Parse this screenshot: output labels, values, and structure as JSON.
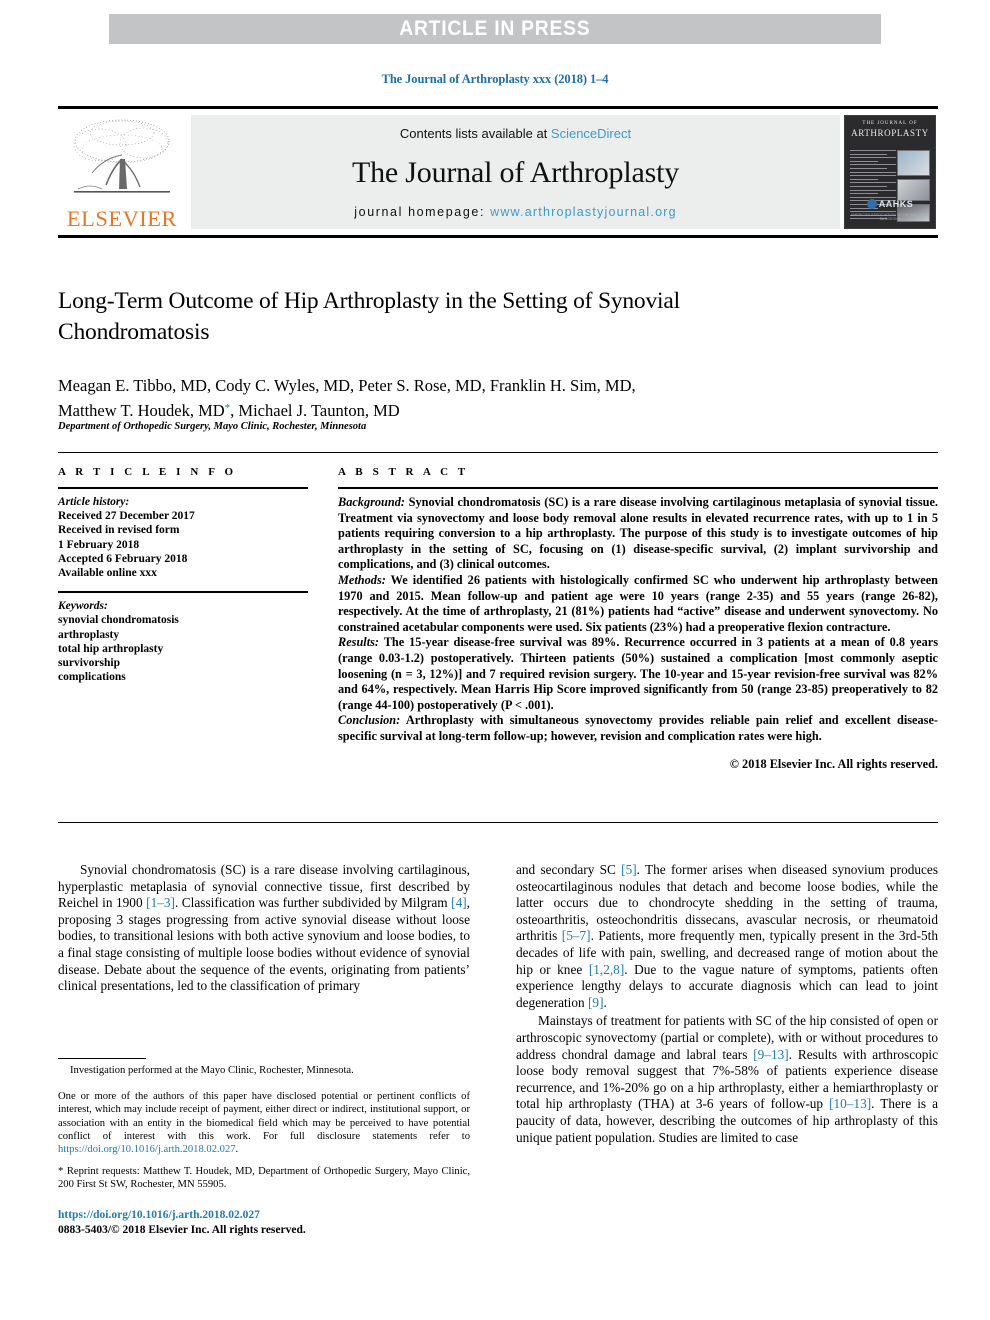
{
  "banner": {
    "text": "ARTICLE IN PRESS",
    "background_color": "#c2c4c6",
    "text_color": "#ffffff"
  },
  "running_head": "The Journal of Arthroplasty xxx (2018) 1–4",
  "masthead": {
    "publisher_logo_text": "ELSEVIER",
    "publisher_logo_color": "#e87722",
    "contents_prefix": "Contents lists available at ",
    "contents_link": "ScienceDirect",
    "journal_title": "The Journal of Arthroplasty",
    "homepage_prefix": "journal homepage: ",
    "homepage_url": "www.arthroplastyjournal.org",
    "link_color": "#3a9bd0",
    "cover": {
      "line1": "THE JOURNAL OF",
      "line2": "ARTHROPLASTY",
      "society": "AAHKS",
      "society_sub": "AMERICAN ASSOCIATION OF HIP AND KNEE SURGEONS"
    }
  },
  "article": {
    "title": "Long-Term Outcome of Hip Arthroplasty in the Setting of Synovial Chondromatosis",
    "authors_line1": "Meagan E. Tibbo, MD, Cody C. Wyles, MD, Peter S. Rose, MD, Franklin H. Sim, MD,",
    "authors_line2_a": "Matthew T. Houdek, MD",
    "authors_corresponding_marker": "*",
    "authors_line2_b": ", Michael J. Taunton, MD",
    "affiliation": "Department of Orthopedic Surgery, Mayo Clinic, Rochester, Minnesota"
  },
  "article_info": {
    "heading": "A R T I C L E   I N F O",
    "history_label": "Article history:",
    "history": [
      "Received 27 December 2017",
      "Received in revised form",
      "1 February 2018",
      "Accepted 6 February 2018",
      "Available online xxx"
    ],
    "keywords_label": "Keywords:",
    "keywords": [
      "synovial chondromatosis",
      "arthroplasty",
      "total hip arthroplasty",
      "survivorship",
      "complications"
    ]
  },
  "abstract": {
    "heading": "A B S T R A C T",
    "sections": [
      {
        "label": "Background:",
        "text": " Synovial chondromatosis (SC) is a rare disease involving cartilaginous metaplasia of synovial tissue. Treatment via synovectomy and loose body removal alone results in elevated recurrence rates, with up to 1 in 5 patients requiring conversion to a hip arthroplasty. The purpose of this study is to investigate outcomes of hip arthroplasty in the setting of SC, focusing on (1) disease-specific survival, (2) implant survivorship and complications, and (3) clinical outcomes."
      },
      {
        "label": "Methods:",
        "text": " We identified 26 patients with histologically confirmed SC who underwent hip arthroplasty between 1970 and 2015. Mean follow-up and patient age were 10 years (range 2-35) and 55 years (range 26-82), respectively. At the time of arthroplasty, 21 (81%) patients had “active” disease and underwent synovectomy. No constrained acetabular components were used. Six patients (23%) had a preoperative flexion contracture."
      },
      {
        "label": "Results:",
        "text": " The 15-year disease-free survival was 89%. Recurrence occurred in 3 patients at a mean of 0.8 years (range 0.03-1.2) postoperatively. Thirteen patients (50%) sustained a complication [most commonly aseptic loosening (n = 3, 12%)] and 7 required revision surgery. The 10-year and 15-year revision-free survival was 82% and 64%, respectively. Mean Harris Hip Score improved significantly from 50 (range 23-85) preoperatively to 82 (range 44-100) postoperatively (P < .001)."
      },
      {
        "label": "Conclusion:",
        "text": " Arthroplasty with simultaneous synovectomy provides reliable pain relief and excellent disease-specific survival at long-term follow-up; however, revision and complication rates were high."
      }
    ],
    "copyright": "© 2018 Elsevier Inc. All rights reserved."
  },
  "body": {
    "left_paragraphs": [
      {
        "parts": [
          {
            "t": "Synovial chondromatosis (SC) is a rare disease involving cartilaginous, hyperplastic metaplasia of synovial connective tissue, first described by Reichel in 1900 ",
            "ref": false
          },
          {
            "t": "[1–3]",
            "ref": true
          },
          {
            "t": ". Classification was further subdivided by Milgram ",
            "ref": false
          },
          {
            "t": "[4]",
            "ref": true
          },
          {
            "t": ", proposing 3 stages progressing from active synovial disease without loose bodies, to transitional lesions with both active synovium and loose bodies, to a final stage consisting of multiple loose bodies without evidence of synovial disease. Debate about the sequence of the events, originating from patients’ clinical presentations, led to the classification of primary",
            "ref": false
          }
        ]
      }
    ],
    "right_paragraphs": [
      {
        "indent": false,
        "parts": [
          {
            "t": "and secondary SC ",
            "ref": false
          },
          {
            "t": "[5]",
            "ref": true
          },
          {
            "t": ". The former arises when diseased synovium produces osteocartilaginous nodules that detach and become loose bodies, while the latter occurs due to chondrocyte shedding in the setting of trauma, osteoarthritis, osteochondritis dissecans, avascular necrosis, or rheumatoid arthritis ",
            "ref": false
          },
          {
            "t": "[5–7]",
            "ref": true
          },
          {
            "t": ". Patients, more frequently men, typically present in the 3rd-5th decades of life with pain, swelling, and decreased range of motion about the hip or knee ",
            "ref": false
          },
          {
            "t": "[1,2,8]",
            "ref": true
          },
          {
            "t": ". Due to the vague nature of symptoms, patients often experience lengthy delays to accurate diagnosis which can lead to joint degeneration ",
            "ref": false
          },
          {
            "t": "[9]",
            "ref": true
          },
          {
            "t": ".",
            "ref": false
          }
        ]
      },
      {
        "indent": true,
        "parts": [
          {
            "t": "Mainstays of treatment for patients with SC of the hip consisted of open or arthroscopic synovectomy (partial or complete), with or without procedures to address chondral damage and labral tears ",
            "ref": false
          },
          {
            "t": "[9–13]",
            "ref": true
          },
          {
            "t": ". Results with arthroscopic loose body removal suggest that 7%-58% of patients experience disease recurrence, and 1%-20% go on a hip arthroplasty, either a hemiarthroplasty or total hip arthroplasty (THA) at 3-6 years of follow-up ",
            "ref": false
          },
          {
            "t": "[10–13]",
            "ref": true
          },
          {
            "t": ". There is a paucity of data, however, describing the outcomes of hip arthroplasty of this unique patient population. Studies are limited to case",
            "ref": false
          }
        ]
      }
    ]
  },
  "footnotes": {
    "investigation": "Investigation performed at the Mayo Clinic, Rochester, Minnesota.",
    "disclosure_prefix": "One or more of the authors of this paper have disclosed potential or pertinent conflicts of interest, which may include receipt of payment, either direct or indirect, institutional support, or association with an entity in the biomedical field which may be perceived to have potential conflict of interest with this work. For full disclosure statements refer to ",
    "disclosure_link": "https://doi.org/10.1016/j.arth.2018.02.027",
    "disclosure_suffix": ".",
    "reprint_marker": "*",
    "reprint": " Reprint requests: Matthew T. Houdek, MD, Department of Orthopedic Surgery, Mayo Clinic, 200 First St SW, Rochester, MN 55905."
  },
  "doi_block": {
    "doi": "https://doi.org/10.1016/j.arth.2018.02.027",
    "issn_line": "0883-5403/© 2018 Elsevier Inc. All rights reserved."
  }
}
